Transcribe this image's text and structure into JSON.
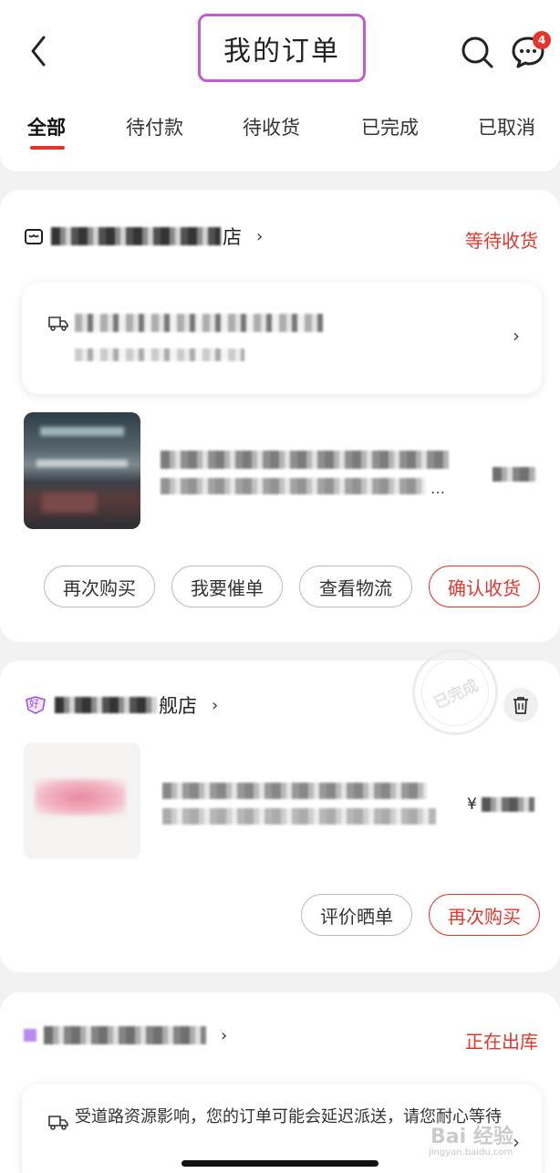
{
  "header": {
    "title": "我的订单",
    "message_badge": "4"
  },
  "tabs": [
    {
      "label": "全部",
      "active": true
    },
    {
      "label": "待付款",
      "active": false
    },
    {
      "label": "待收货",
      "active": false
    },
    {
      "label": "已完成",
      "active": false
    },
    {
      "label": "已取消",
      "active": false
    }
  ],
  "orders": [
    {
      "store_suffix": "店",
      "status": "等待收货",
      "item_ellipsis": "…",
      "buttons": [
        "再次购买",
        "我要催单",
        "查看物流",
        "确认收货"
      ]
    },
    {
      "store_prefix_icon": "好",
      "store_suffix": "舰店",
      "stamp": "已完成",
      "price_symbol": "¥",
      "buttons": [
        "评价晒单",
        "再次购买"
      ]
    },
    {
      "status": "正在出库",
      "delivery_notice": "受道路资源影响，您的订单可能会延迟派送，请您耐心等待"
    }
  ],
  "watermark": {
    "brand": "Bai 经验",
    "sub": "jingyan.baidu.com"
  },
  "colors": {
    "accent": "#e5352b",
    "title_highlight": "#c45bd0",
    "background": "#f2f2f2"
  }
}
